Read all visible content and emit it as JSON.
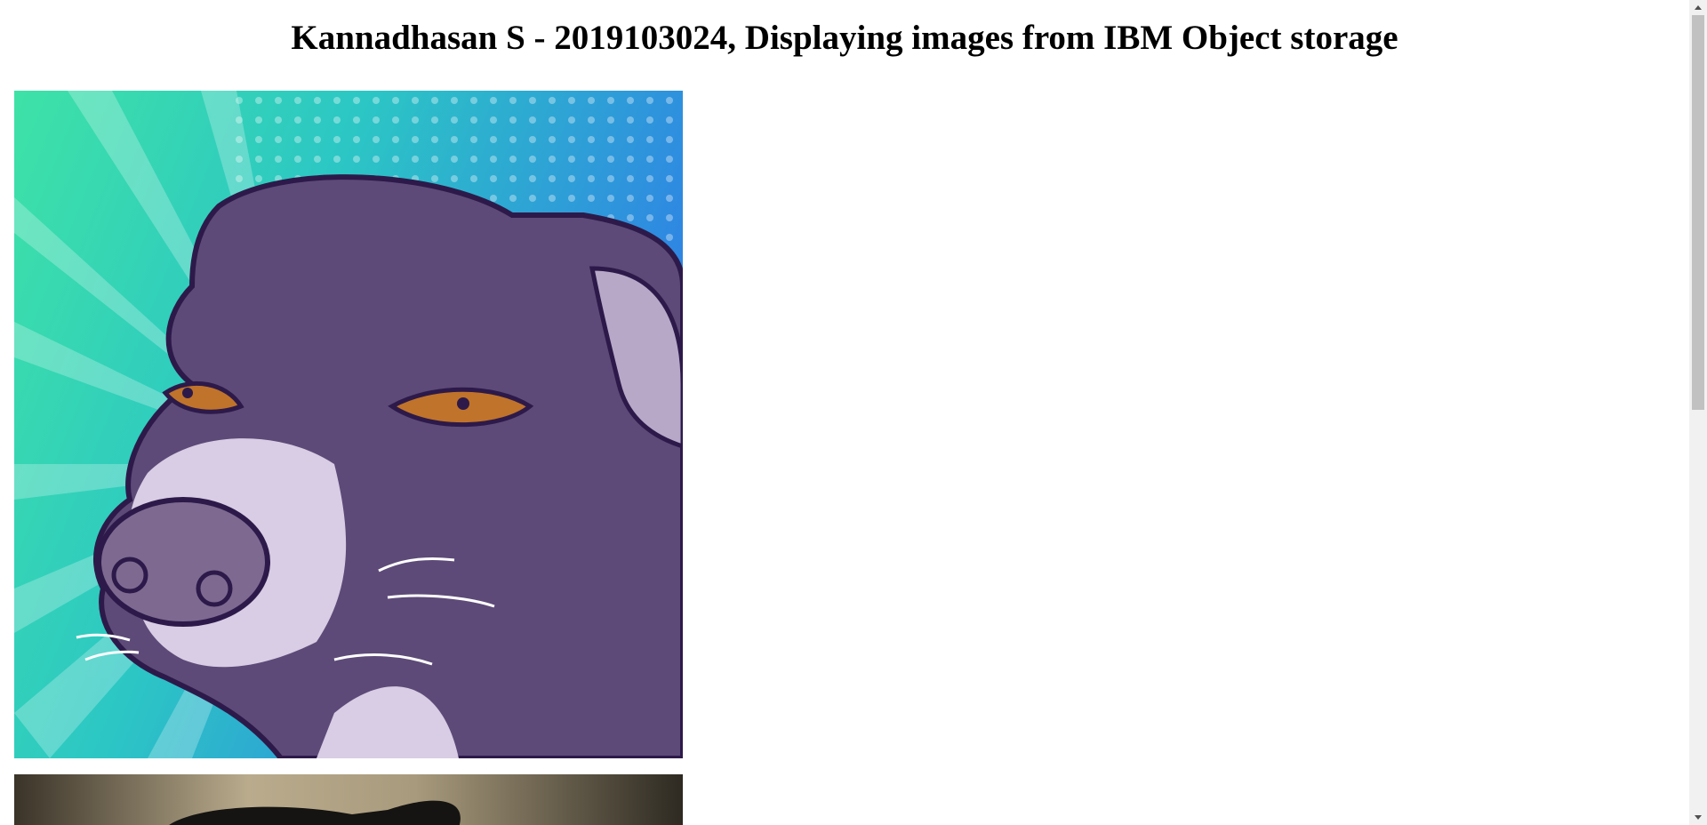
{
  "page": {
    "heading": "Kannadhasan S - 2019103024, Displaying images from IBM Object storage"
  },
  "images": [
    {
      "name": "cartoon-dog-image"
    },
    {
      "name": "dog-photo-image"
    }
  ],
  "colors": {
    "background": "#ffffff",
    "scrollbar_track": "#f1f1f1",
    "scrollbar_thumb": "#c1c1c1"
  }
}
